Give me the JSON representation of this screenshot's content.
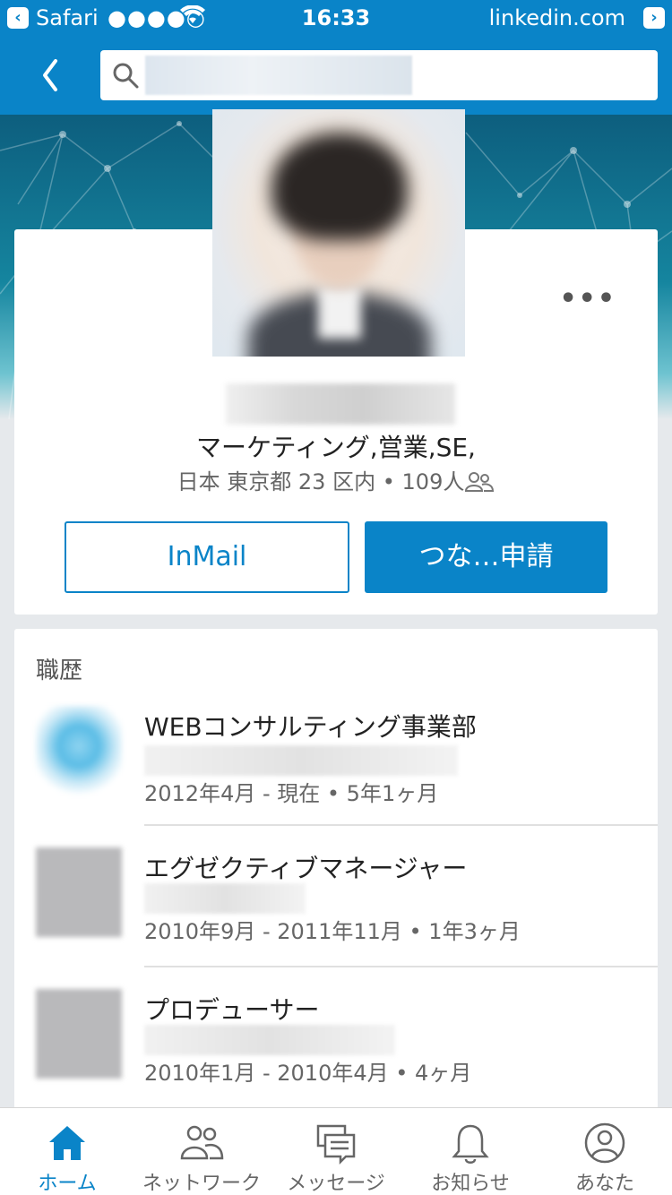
{
  "status_bar": {
    "app": "Safari",
    "signal": "●●●●○",
    "time": "16:33",
    "site": "linkedin.com"
  },
  "nav": {
    "search_value": ""
  },
  "profile": {
    "headline": "マーケティング,営業,SE,",
    "location": "日本 東京都 23 区内",
    "connections": "109人",
    "inmail_label": "InMail",
    "connect_label": "つな…申請"
  },
  "experience": {
    "title": "職歴",
    "items": [
      {
        "title": "WEBコンサルティング事業部",
        "dates": "2012年4月 - 現在 • 5年1ヶ月"
      },
      {
        "title": "エグゼクティブマネージャー",
        "dates": "2010年9月 - 2011年11月 • 1年3ヶ月"
      },
      {
        "title": "プロデューサー",
        "dates": "2010年1月 - 2010年4月 • 4ヶ月"
      }
    ]
  },
  "tabs": [
    {
      "label": "ホーム",
      "icon": "home-icon",
      "active": true
    },
    {
      "label": "ネットワーク",
      "icon": "network-icon",
      "active": false
    },
    {
      "label": "メッセージ",
      "icon": "messages-icon",
      "active": false
    },
    {
      "label": "お知らせ",
      "icon": "bell-icon",
      "active": false
    },
    {
      "label": "あなた",
      "icon": "profile-icon",
      "active": false
    }
  ],
  "colors": {
    "brand": "#0a84c8",
    "background": "#e6e9ec"
  }
}
